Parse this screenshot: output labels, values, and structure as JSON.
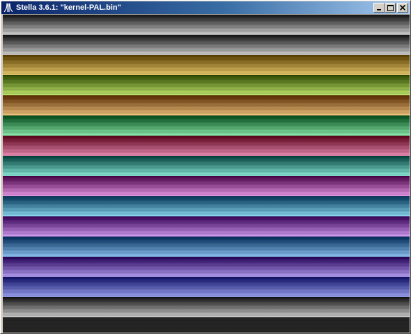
{
  "window": {
    "title": "Stella 3.6.1: \"kernel-PAL.bin\"",
    "icon": "atari-fuji-icon"
  },
  "titlebar_buttons": {
    "minimize_icon": "minimize-icon",
    "maximize_icon": "maximize-icon",
    "close_icon": "close-icon"
  },
  "display": {
    "bands": [
      {
        "name": "gray",
        "dark": "#111111",
        "light": "#d6d6d6"
      },
      {
        "name": "gray",
        "dark": "#111111",
        "light": "#d6d6d6"
      },
      {
        "name": "gold",
        "dark": "#5a3f00",
        "light": "#f2d070"
      },
      {
        "name": "lime",
        "dark": "#2f4a00",
        "light": "#c8f070"
      },
      {
        "name": "orange",
        "dark": "#5a2a00",
        "light": "#f5c880"
      },
      {
        "name": "green",
        "dark": "#004a18",
        "light": "#90f0b0"
      },
      {
        "name": "red",
        "dark": "#5a0018",
        "light": "#f090b8"
      },
      {
        "name": "teal",
        "dark": "#00403c",
        "light": "#90f0e0"
      },
      {
        "name": "magenta",
        "dark": "#4a0048",
        "light": "#f0a0f0"
      },
      {
        "name": "cyan",
        "dark": "#003458",
        "light": "#90e0f8"
      },
      {
        "name": "purple",
        "dark": "#36005a",
        "light": "#d8a0f8"
      },
      {
        "name": "blue",
        "dark": "#002a5a",
        "light": "#90c8f8"
      },
      {
        "name": "violet",
        "dark": "#24005a",
        "light": "#b8a0f8"
      },
      {
        "name": "indigo",
        "dark": "#10106a",
        "light": "#a0a8f8"
      },
      {
        "name": "gray",
        "dark": "#111111",
        "light": "#d6d6d6"
      },
      {
        "name": "dark",
        "dark": "#262626",
        "light": "#262626"
      }
    ]
  }
}
